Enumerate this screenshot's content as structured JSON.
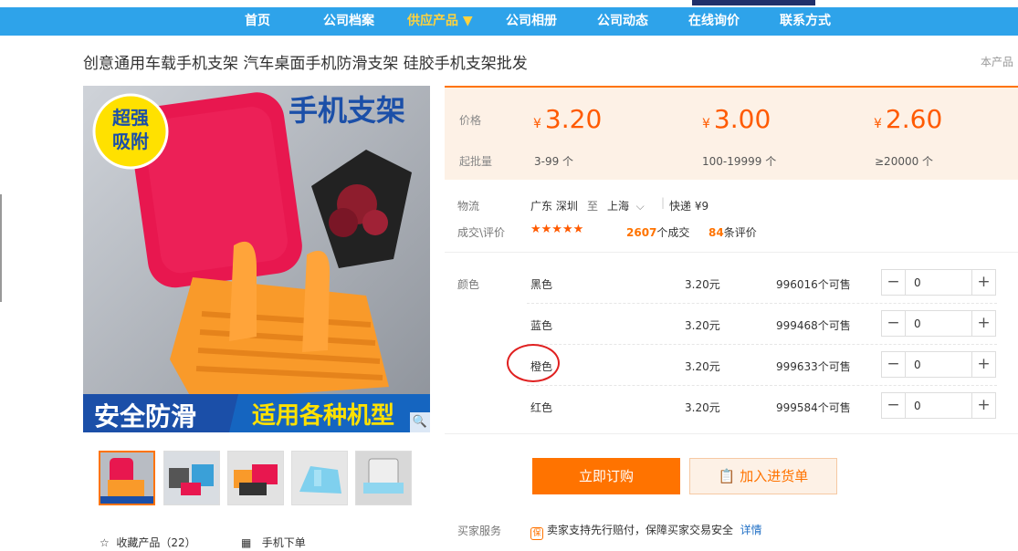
{
  "nav": {
    "items": [
      "首页",
      "公司档案",
      "供应产品 ▼",
      "公司相册",
      "公司动态",
      "在线询价",
      "联系方式"
    ]
  },
  "title": "创意通用车载手机支架 汽车桌面手机防滑支架 硅胶手机支架批发",
  "title_right": "本产品",
  "image": {
    "badge": "超强吸附",
    "headline": "手机支架",
    "banner_left": "安全防滑",
    "banner_right": "适用各种机型",
    "zoom_icon": "magnifier-icon"
  },
  "actions": {
    "favorite": "收藏产品（22）",
    "mobile_order": "手机下单"
  },
  "price": {
    "price_label": "价格",
    "min_label": "起批量",
    "tiers": [
      {
        "currency": "¥",
        "price": "3.20",
        "qty": "3-99 个"
      },
      {
        "currency": "¥",
        "price": "3.00",
        "qty": "100-19999 个"
      },
      {
        "currency": "¥",
        "price": "2.60",
        "qty": "≥20000 个"
      }
    ]
  },
  "logistics": {
    "label": "物流",
    "from": "广东 深圳",
    "to_word": "至",
    "to": "上海",
    "express": "快递 ¥9"
  },
  "deals": {
    "label": "成交\\评价",
    "stars": "★★★★★",
    "count": "2607",
    "count_suffix": "个成交",
    "reviews": "84",
    "reviews_suffix": "条评价"
  },
  "color_label": "颜色",
  "variants": [
    {
      "name": "黑色",
      "price": "3.20元",
      "stock": "996016个可售",
      "qty": "0"
    },
    {
      "name": "蓝色",
      "price": "3.20元",
      "stock": "999468个可售",
      "qty": "0"
    },
    {
      "name": "橙色",
      "price": "3.20元",
      "stock": "999633个可售",
      "qty": "0"
    },
    {
      "name": "红色",
      "price": "3.20元",
      "stock": "999584个可售",
      "qty": "0"
    }
  ],
  "buttons": {
    "order": "立即订购",
    "cart": "加入进货单"
  },
  "service": {
    "label": "买家服务",
    "badge": "保",
    "text": "卖家支持先行赔付，保障买家交易安全",
    "link": "详情"
  },
  "colors": {
    "nav_bg": "#2ea3ea",
    "accent": "#ff7300",
    "price": "#ff5a00",
    "annotation": "#e02020"
  }
}
